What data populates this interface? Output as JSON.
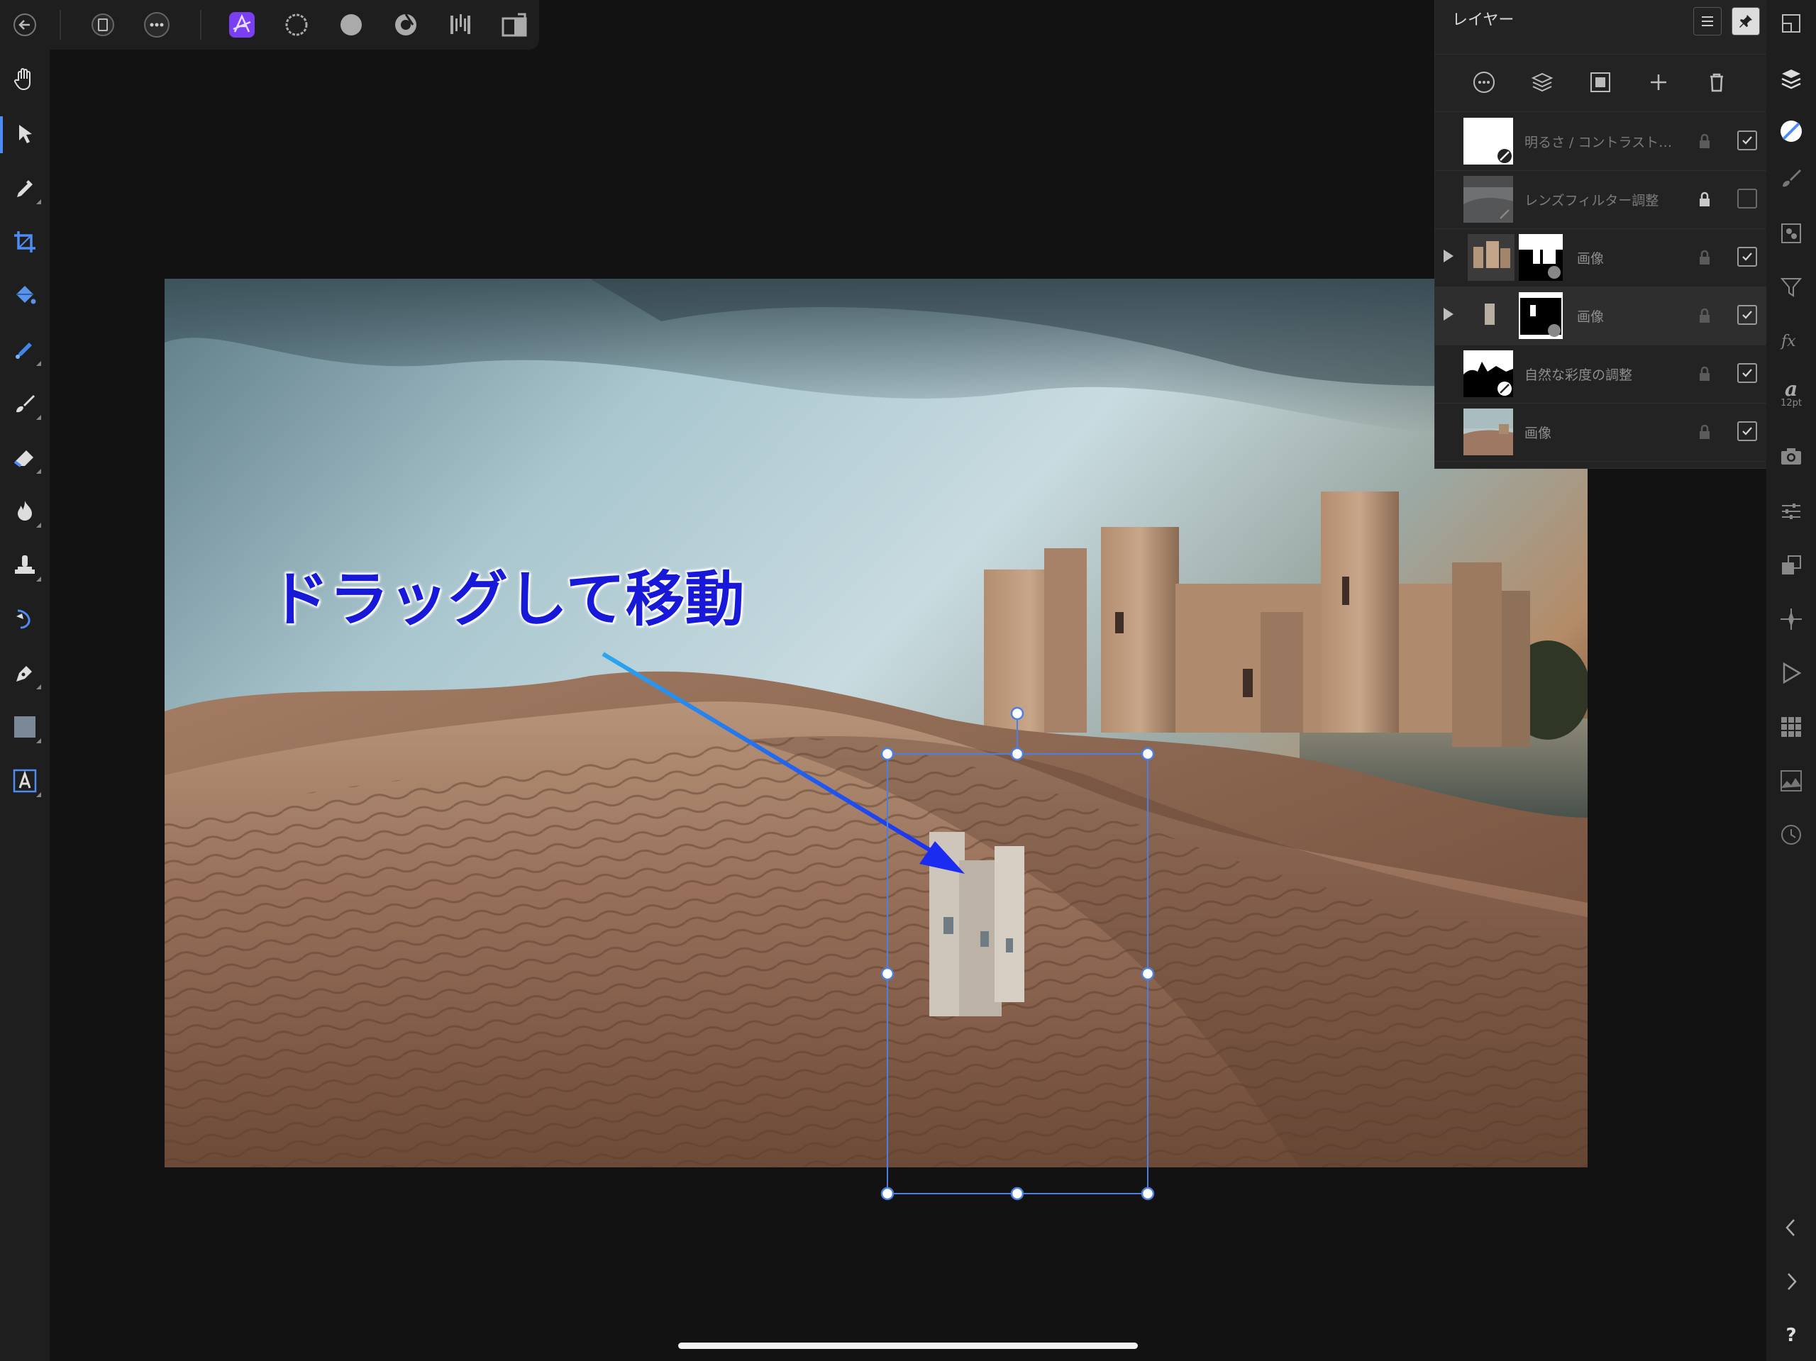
{
  "panel": {
    "title": "レイヤー",
    "layers": [
      {
        "name": "明るさ / コントラスト…",
        "visible": true,
        "dim": true,
        "selected": false,
        "expandable": false
      },
      {
        "name": "レンズフィルター調整",
        "visible": false,
        "dim": true,
        "selected": false,
        "expandable": false
      },
      {
        "name": "画像",
        "visible": true,
        "dim": false,
        "selected": false,
        "expandable": true
      },
      {
        "name": "画像",
        "visible": true,
        "dim": false,
        "selected": true,
        "expandable": true
      },
      {
        "name": "自然な彩度の調整",
        "visible": true,
        "dim": false,
        "selected": false,
        "expandable": false
      },
      {
        "name": "画像",
        "visible": true,
        "dim": false,
        "selected": false,
        "expandable": false
      }
    ]
  },
  "annotation": {
    "text": "ドラッグして移動",
    "color": "#1818d8"
  },
  "rightbar": {
    "font_size_label": "12pt"
  },
  "rightbar_bottom": {
    "help_label": "?"
  },
  "colors": {
    "accent": "#4d8cf5",
    "persona_active": "#7b3ff2",
    "arrow": "#1a2cf0",
    "arrow_light": "#2aa8f0",
    "background": "#121212",
    "panel": "#232323"
  },
  "icons": {
    "top": [
      "back-icon",
      "document-icon",
      "more-icon",
      "photo-persona-icon",
      "liquify-persona-icon",
      "develop-persona-icon",
      "tone-mapping-persona-icon",
      "export-persona-icon",
      "split-view-icon"
    ],
    "left": [
      "hand-icon",
      "move-icon",
      "color-picker-icon",
      "crop-icon",
      "flood-fill-icon",
      "selection-brush-icon",
      "paint-brush-icon",
      "eraser-icon",
      "burn-icon",
      "clone-icon",
      "healing-icon",
      "pen-icon",
      "rectangle-icon",
      "text-icon"
    ],
    "right": [
      "navigator-icon",
      "layers-icon",
      "adjustments-icon",
      "brushes-icon",
      "channels-icon",
      "filters-icon",
      "effects-icon",
      "text-styles-icon",
      "snapshots-icon",
      "adjust-sliders-icon",
      "transform-icon",
      "symbols-icon",
      "macros-icon",
      "library-icon",
      "histogram-icon",
      "history-icon",
      "collapse-left-icon",
      "collapse-right-icon",
      "help-icon"
    ]
  }
}
